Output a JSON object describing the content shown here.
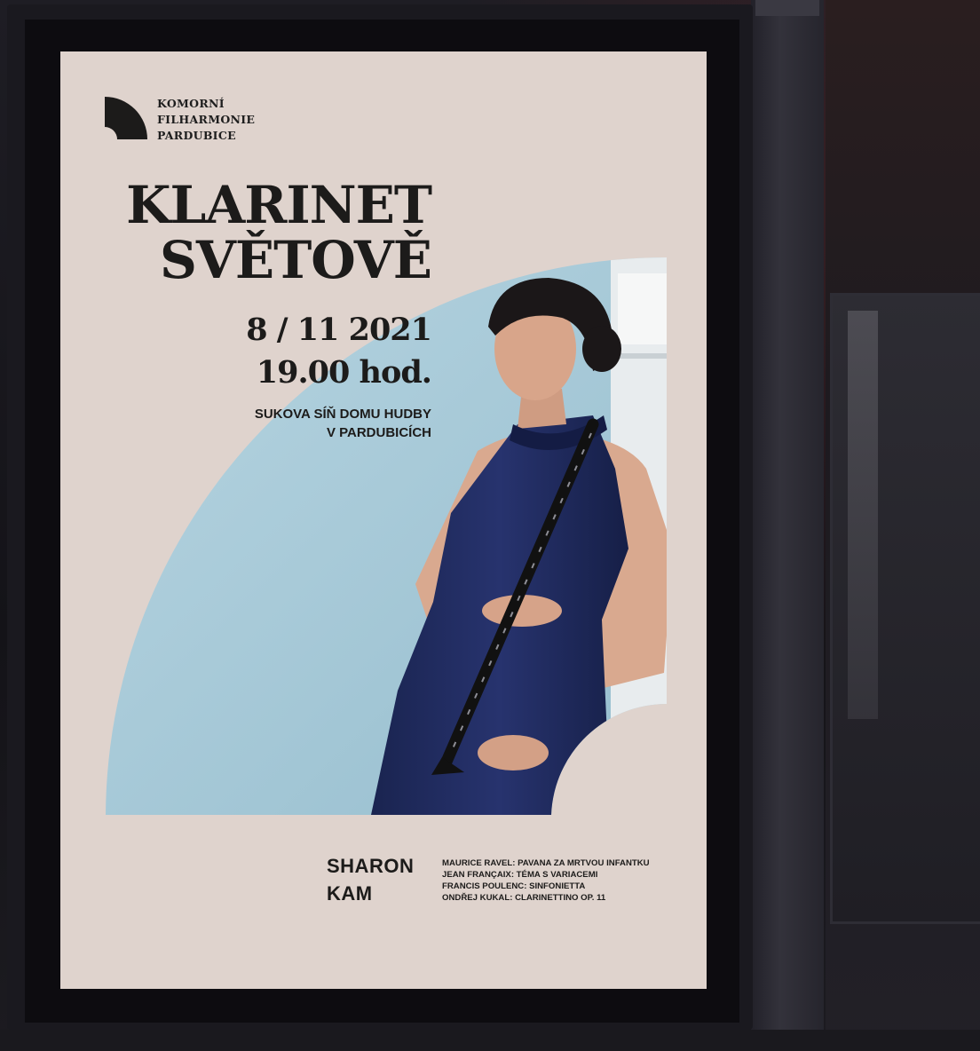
{
  "poster": {
    "organizer": [
      "KOMORNÍ",
      "FILHARMONIE",
      "PARDUBICE"
    ],
    "title": [
      "KLARINET",
      "SVĚTOVĚ"
    ],
    "date": "8 / 11 2021",
    "time": "19.00 hod.",
    "venue": [
      "SUKOVA SÍŇ DOMU HUDBY",
      "V PARDUBICÍCH"
    ],
    "soloist": [
      "SHARON",
      "KAM"
    ],
    "program": [
      "MAURICE RAVEL: PAVANA ZA MRTVOU INFANTKU",
      "JEAN FRANÇAIX: TÉMA S VARIACEMI",
      "FRANCIS POULENC: SINFONIETTA",
      "ONDŘEJ KUKAL: CLARINETTINO OP. 11"
    ]
  },
  "colors": {
    "poster_bg": "#dfd3cd",
    "photo_bg": "#a9cbd9",
    "dress": "#1f2a5e",
    "text": "#1c1b1a"
  },
  "icons": {
    "logo": "quarter-circle-logo-icon",
    "photo": "clarinetist-portrait"
  }
}
